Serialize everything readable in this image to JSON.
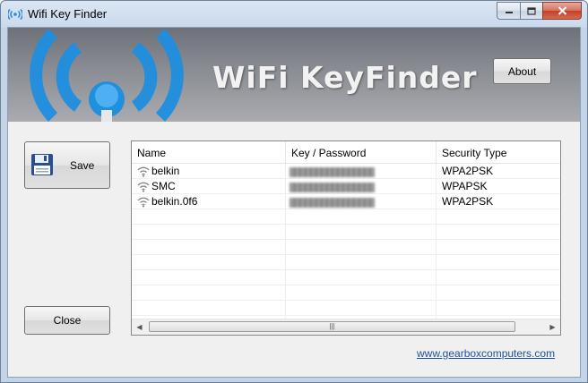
{
  "window": {
    "title": "Wifi Key Finder",
    "app_icon": "wifi-icon",
    "controls": {
      "minimize": "minimize-icon",
      "maximize": "maximize-icon",
      "close": "close-icon"
    }
  },
  "banner": {
    "title": "WiFi KeyFinder",
    "about_label": "About"
  },
  "buttons": {
    "save_label": "Save",
    "close_label": "Close"
  },
  "table": {
    "columns": [
      "Name",
      "Key / Password",
      "Security Type"
    ],
    "rows": [
      {
        "name": "belkin",
        "key": "",
        "security": "WPA2PSK"
      },
      {
        "name": "SMC",
        "key": "",
        "security": "WPAPSK"
      },
      {
        "name": "belkin.0f6",
        "key": "",
        "security": "WPA2PSK"
      }
    ]
  },
  "footer": {
    "link_text": "www.gearboxcomputers.com"
  },
  "colors": {
    "link": "#1e4f9e",
    "banner_logo_blue": "#1f8fe0"
  }
}
